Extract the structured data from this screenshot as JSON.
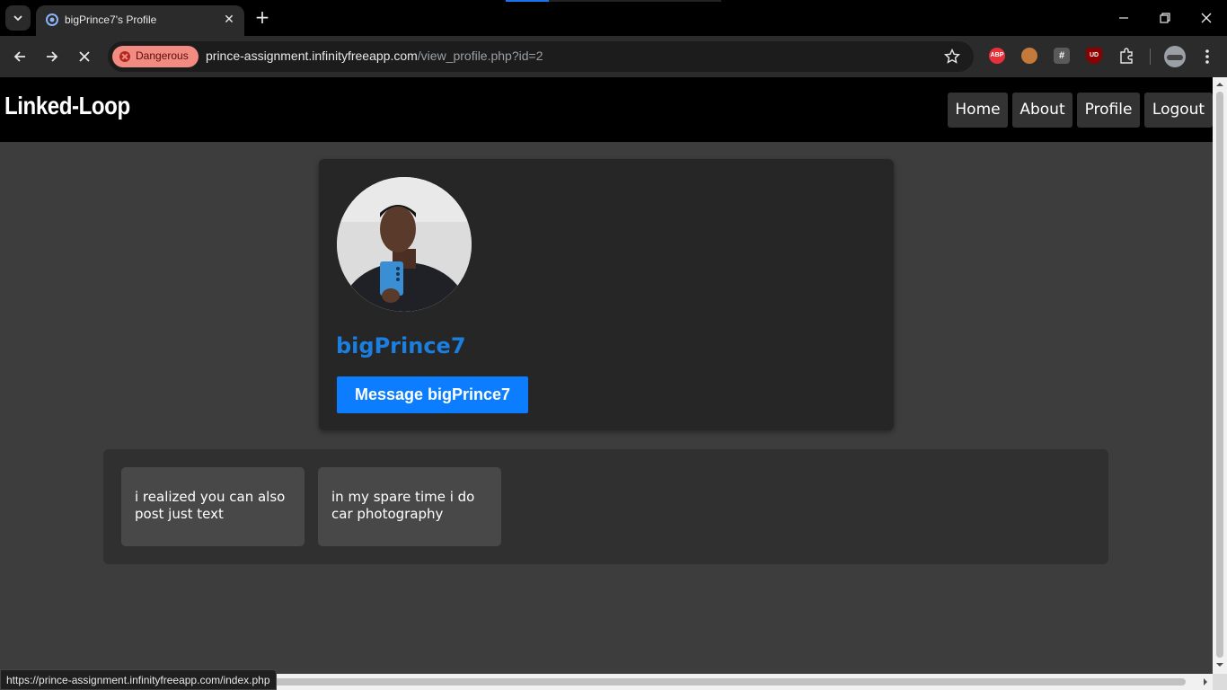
{
  "browser": {
    "tab_title": "bigPrince7's Profile",
    "security_label": "Dangerous",
    "url_host": "prince-assignment.infinityfreeapp.com",
    "url_path": "/view_profile.php?id=2",
    "status_url": "https://prince-assignment.infinityfreeapp.com/index.php",
    "extensions": [
      "ABP",
      "cookie",
      "#",
      "UD"
    ]
  },
  "site": {
    "logo": "Linked-Loop",
    "nav": [
      "Home",
      "About",
      "Profile",
      "Logout"
    ]
  },
  "profile": {
    "username": "bigPrince7",
    "message_button": "Message bigPrince7"
  },
  "posts": [
    "i realized you can also post just text",
    "in my spare time i do car photography"
  ],
  "colors": {
    "accent": "#0b7dfe",
    "username": "#1a7fe0",
    "danger": "#f28b82"
  }
}
